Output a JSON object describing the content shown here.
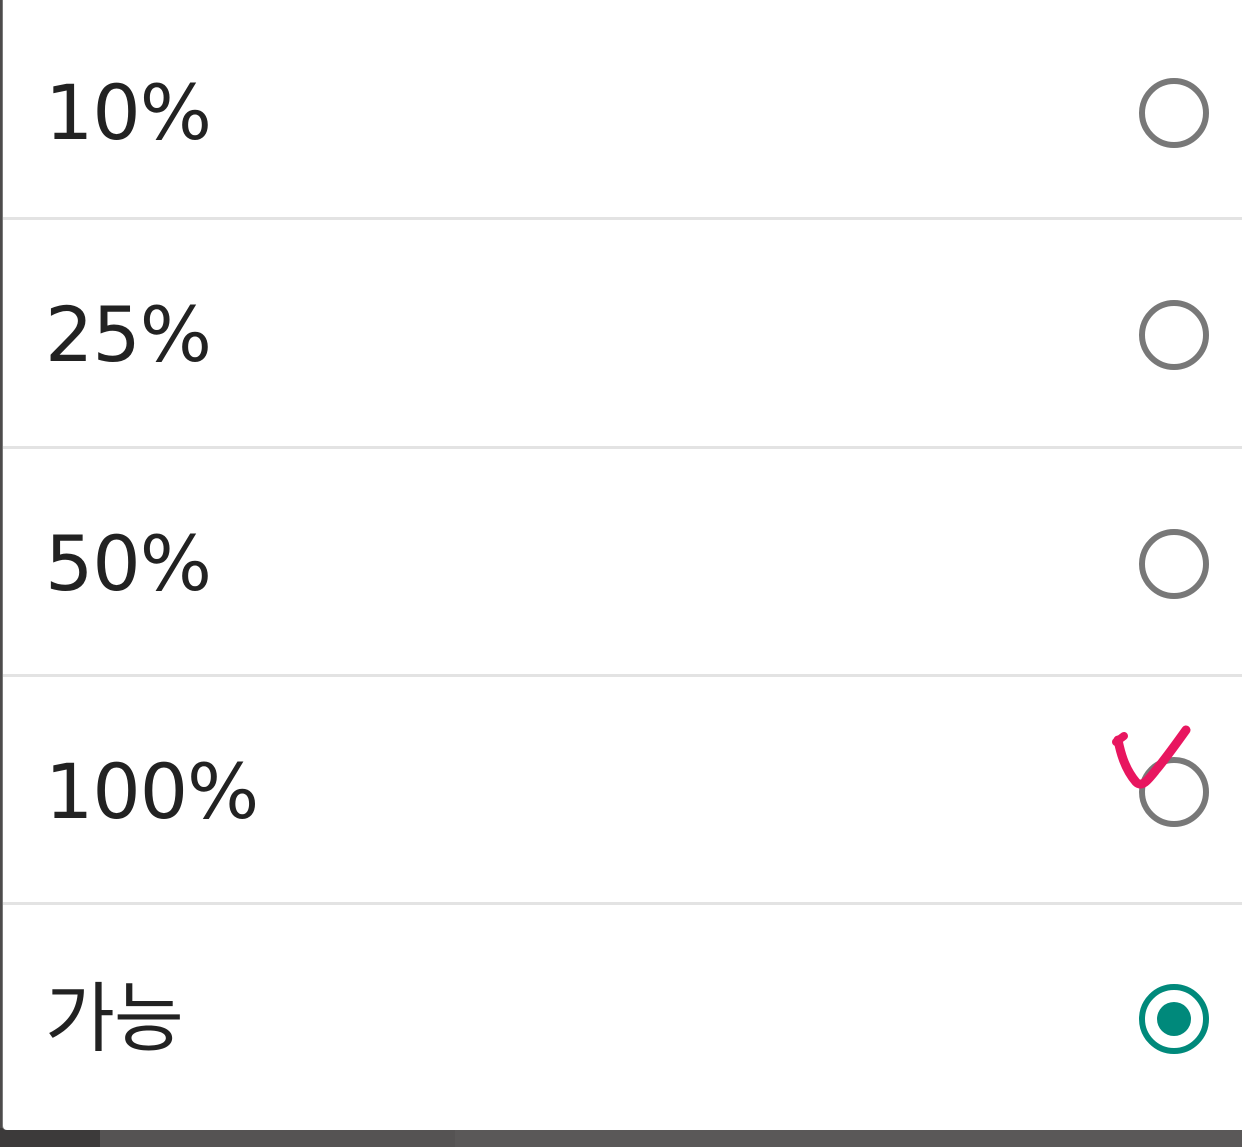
{
  "options": [
    {
      "label": "10%",
      "selected": false
    },
    {
      "label": "25%",
      "selected": false
    },
    {
      "label": "50%",
      "selected": false
    },
    {
      "label": "100%",
      "selected": false
    },
    {
      "label": "가능",
      "selected": true
    }
  ],
  "colors": {
    "selected_radio": "#00897b",
    "unselected_radio": "#787878",
    "annotation": "#e8165f",
    "divider": "#e3e3e3"
  },
  "annotation_icon": "handwritten-check-icon"
}
